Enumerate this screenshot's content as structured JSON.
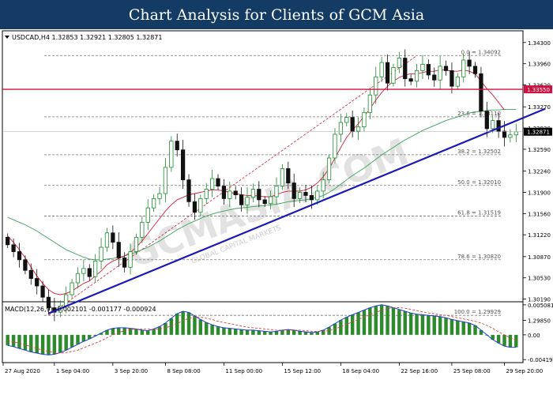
{
  "banner": {
    "title": "Chart Analysis for Clients of GCM Asia"
  },
  "header": {
    "symbol_line": "USDCAD,H4  1.32853 1.32921 1.32805 1.32871"
  },
  "watermark": {
    "text": "GCMASIA.COM",
    "subtext": "GLOBAL CAPITAL MARKETS"
  },
  "colors": {
    "up": "#1c8a2e",
    "down": "#111111",
    "ma_fast": "#d81e3a",
    "ma_slow": "#3aa35a",
    "trend": "#1a1ab8",
    "resistance": "#d01040",
    "macd": "#1f3fd0",
    "signal": "#e04040",
    "hist": "#2d8a2d",
    "fib": "#777777"
  },
  "chart_data": [
    {
      "type": "candlestick",
      "title": "USDCAD,H4",
      "ohlc_header": "1.32853 1.32921 1.32805 1.32871",
      "x_ticks": [
        "27 Aug 2020",
        "1 Sep 04:00",
        "3 Sep 20:00",
        "8 Sep 08:00",
        "11 Sep 00:00",
        "15 Sep 12:00",
        "18 Sep 04:00",
        "22 Sep 16:00",
        "25 Sep 08:00",
        "29 Sep 20:00"
      ],
      "y_ticks": [
        "1.34300",
        "1.33960",
        "1.33620",
        "1.33270",
        "1.32930",
        "1.32590",
        "1.32240",
        "1.31900",
        "1.31560",
        "1.31220",
        "1.30870",
        "1.30530",
        "1.30190",
        "1.29850"
      ],
      "ylim": [
        1.2983,
        1.3445
      ],
      "current_price": "1.32871",
      "resistance": {
        "label": "1.33550",
        "value": 1.3355
      },
      "fibonacci": [
        {
          "label": "0.0 = 1.34092",
          "value": 1.34092
        },
        {
          "label": "23.6 = 1.33110",
          "value": 1.3311
        },
        {
          "label": "38.2 = 1.32502",
          "value": 1.32502
        },
        {
          "label": "50.0 = 1.32010",
          "value": 1.3201
        },
        {
          "label": "61.8 = 1.31519",
          "value": 1.31519
        },
        {
          "label": "78.6 = 1.30820",
          "value": 1.3082
        },
        {
          "label": "100.0 = 1.29929",
          "value": 1.29929
        }
      ],
      "trendline": {
        "start": [
          7,
          1.2996
        ],
        "end": [
          92,
          1.3324
        ]
      },
      "fib_diagonal": {
        "start": [
          7,
          1.2993
        ],
        "end": [
          70,
          1.3409
        ]
      },
      "closes": [
        1.3106,
        1.3095,
        1.3082,
        1.3065,
        1.3052,
        1.304,
        1.3022,
        1.3005,
        1.2998,
        1.3008,
        1.3026,
        1.3045,
        1.306,
        1.3068,
        1.3055,
        1.308,
        1.3102,
        1.3125,
        1.311,
        1.3085,
        1.307,
        1.3095,
        1.3118,
        1.3142,
        1.3165,
        1.318,
        1.3188,
        1.323,
        1.3272,
        1.3258,
        1.321,
        1.3175,
        1.3158,
        1.318,
        1.3195,
        1.3212,
        1.32,
        1.318,
        1.3192,
        1.3186,
        1.317,
        1.3182,
        1.3195,
        1.3178,
        1.3172,
        1.3183,
        1.32,
        1.3228,
        1.3205,
        1.318,
        1.319,
        1.3185,
        1.3178,
        1.3192,
        1.321,
        1.3245,
        1.3283,
        1.3302,
        1.331,
        1.3288,
        1.3295,
        1.3318,
        1.3346,
        1.3375,
        1.3398,
        1.3365,
        1.339,
        1.3405,
        1.3372,
        1.3368,
        1.3385,
        1.3395,
        1.3378,
        1.337,
        1.3392,
        1.3385,
        1.336,
        1.3375,
        1.3402,
        1.3392,
        1.338,
        1.332,
        1.3292,
        1.3305,
        1.3288,
        1.3278,
        1.3282,
        1.3287
      ],
      "ma_fast": [
        1.312,
        1.311,
        1.3098,
        1.3085,
        1.307,
        1.3056,
        1.3044,
        1.3034,
        1.3028,
        1.3026,
        1.3028,
        1.3032,
        1.3038,
        1.3044,
        1.3048,
        1.3056,
        1.3064,
        1.3074,
        1.308,
        1.3084,
        1.3088,
        1.3094,
        1.3102,
        1.3112,
        1.3124,
        1.3136,
        1.3148,
        1.316,
        1.317,
        1.3178,
        1.3182,
        1.3186,
        1.3188,
        1.319,
        1.3192,
        1.3194,
        1.3194,
        1.3192,
        1.319,
        1.3188,
        1.3186,
        1.3185,
        1.3185,
        1.3184,
        1.3183,
        1.3183,
        1.3186,
        1.319,
        1.3192,
        1.3192,
        1.3192,
        1.3194,
        1.3198,
        1.3205,
        1.3215,
        1.3228,
        1.3245,
        1.3262,
        1.3278,
        1.329,
        1.33,
        1.3312,
        1.3324,
        1.3338,
        1.335,
        1.336,
        1.3368,
        1.3374,
        1.3378,
        1.338,
        1.338,
        1.3382,
        1.3384,
        1.3384,
        1.3386,
        1.3386,
        1.3384,
        1.3384,
        1.3386,
        1.3384,
        1.338,
        1.3368,
        1.3356,
        1.3346,
        1.3334,
        1.3322
      ],
      "ma_slow": [
        1.315,
        1.3146,
        1.3142,
        1.3138,
        1.3133,
        1.3128,
        1.3122,
        1.3116,
        1.311,
        1.3104,
        1.3098,
        1.3094,
        1.309,
        1.3086,
        1.3083,
        1.3082,
        1.3082,
        1.3083,
        1.3084,
        1.3086,
        1.3088,
        1.3091,
        1.3094,
        1.3098,
        1.3102,
        1.3107,
        1.3112,
        1.3118,
        1.3124,
        1.313,
        1.3135,
        1.314,
        1.3144,
        1.3148,
        1.3152,
        1.3155,
        1.3158,
        1.316,
        1.3162,
        1.3164,
        1.3165,
        1.3166,
        1.3167,
        1.3168,
        1.3169,
        1.317,
        1.3171,
        1.3173,
        1.3175,
        1.3176,
        1.3177,
        1.3178,
        1.318,
        1.3182,
        1.3185,
        1.319,
        1.3196,
        1.3203,
        1.321,
        1.3217,
        1.3223,
        1.3229,
        1.3236,
        1.3243,
        1.325,
        1.3256,
        1.3262,
        1.3268,
        1.3274,
        1.3279,
        1.3284,
        1.3289,
        1.3293,
        1.3297,
        1.3301,
        1.3305,
        1.3308,
        1.3311,
        1.3314,
        1.3317,
        1.3319,
        1.332,
        1.3321,
        1.3322,
        1.3322,
        1.3323,
        1.3323,
        1.3323
      ]
    },
    {
      "type": "line",
      "title": "MACD(12,26,9) -0.002101 -0.001177 -0.000924",
      "y_ticks": [
        "0.005081",
        "0.00",
        "-0.004197"
      ],
      "ylim": [
        -0.0047,
        0.0056
      ],
      "macd": [
        -0.0018,
        -0.002,
        -0.0023,
        -0.0026,
        -0.0029,
        -0.0031,
        -0.0033,
        -0.0034,
        -0.0033,
        -0.003,
        -0.0026,
        -0.0021,
        -0.0016,
        -0.0011,
        -0.0007,
        -0.0002,
        0.0003,
        0.0008,
        0.0011,
        0.0012,
        0.0012,
        0.0011,
        0.001,
        0.0008,
        0.0007,
        0.001,
        0.0014,
        0.002,
        0.0028,
        0.0036,
        0.004,
        0.0038,
        0.0032,
        0.0026,
        0.0021,
        0.0017,
        0.0014,
        0.0012,
        0.0011,
        0.001,
        0.0009,
        0.0008,
        0.0008,
        0.0007,
        0.0006,
        0.0005,
        0.0006,
        0.0008,
        0.0009,
        0.0008,
        0.0006,
        0.0005,
        0.0004,
        0.0005,
        0.0008,
        0.0013,
        0.0019,
        0.0025,
        0.003,
        0.0034,
        0.0038,
        0.0042,
        0.0046,
        0.0049,
        0.0051,
        0.0049,
        0.0046,
        0.0043,
        0.004,
        0.0037,
        0.0035,
        0.0034,
        0.0033,
        0.0032,
        0.0031,
        0.0029,
        0.0026,
        0.0024,
        0.0022,
        0.002,
        0.0016,
        0.0008,
        0.0,
        -0.0008,
        -0.0014,
        -0.0019,
        -0.0021,
        -0.0021
      ],
      "signal": [
        -0.001,
        -0.0012,
        -0.0014,
        -0.0017,
        -0.002,
        -0.0023,
        -0.0026,
        -0.0028,
        -0.003,
        -0.0031,
        -0.003,
        -0.0028,
        -0.0026,
        -0.0022,
        -0.0018,
        -0.0014,
        -0.001,
        -0.0005,
        0.0,
        0.0004,
        0.0007,
        0.0009,
        0.001,
        0.001,
        0.001,
        0.0009,
        0.001,
        0.0012,
        0.0015,
        0.0019,
        0.0024,
        0.0028,
        0.003,
        0.003,
        0.0028,
        0.0026,
        0.0023,
        0.0021,
        0.0019,
        0.0017,
        0.0015,
        0.0013,
        0.0012,
        0.0011,
        0.001,
        0.0009,
        0.0008,
        0.0008,
        0.0008,
        0.0008,
        0.0008,
        0.0007,
        0.0006,
        0.0006,
        0.0006,
        0.0007,
        0.001,
        0.0014,
        0.0018,
        0.0022,
        0.0026,
        0.003,
        0.0034,
        0.0038,
        0.0042,
        0.0045,
        0.0046,
        0.0046,
        0.0045,
        0.0043,
        0.0041,
        0.0039,
        0.0037,
        0.0036,
        0.0034,
        0.0033,
        0.0031,
        0.0029,
        0.0027,
        0.0025,
        0.0023,
        0.002,
        0.0016,
        0.0011,
        0.0005,
        0.0,
        -0.0005,
        -0.0009
      ]
    }
  ]
}
